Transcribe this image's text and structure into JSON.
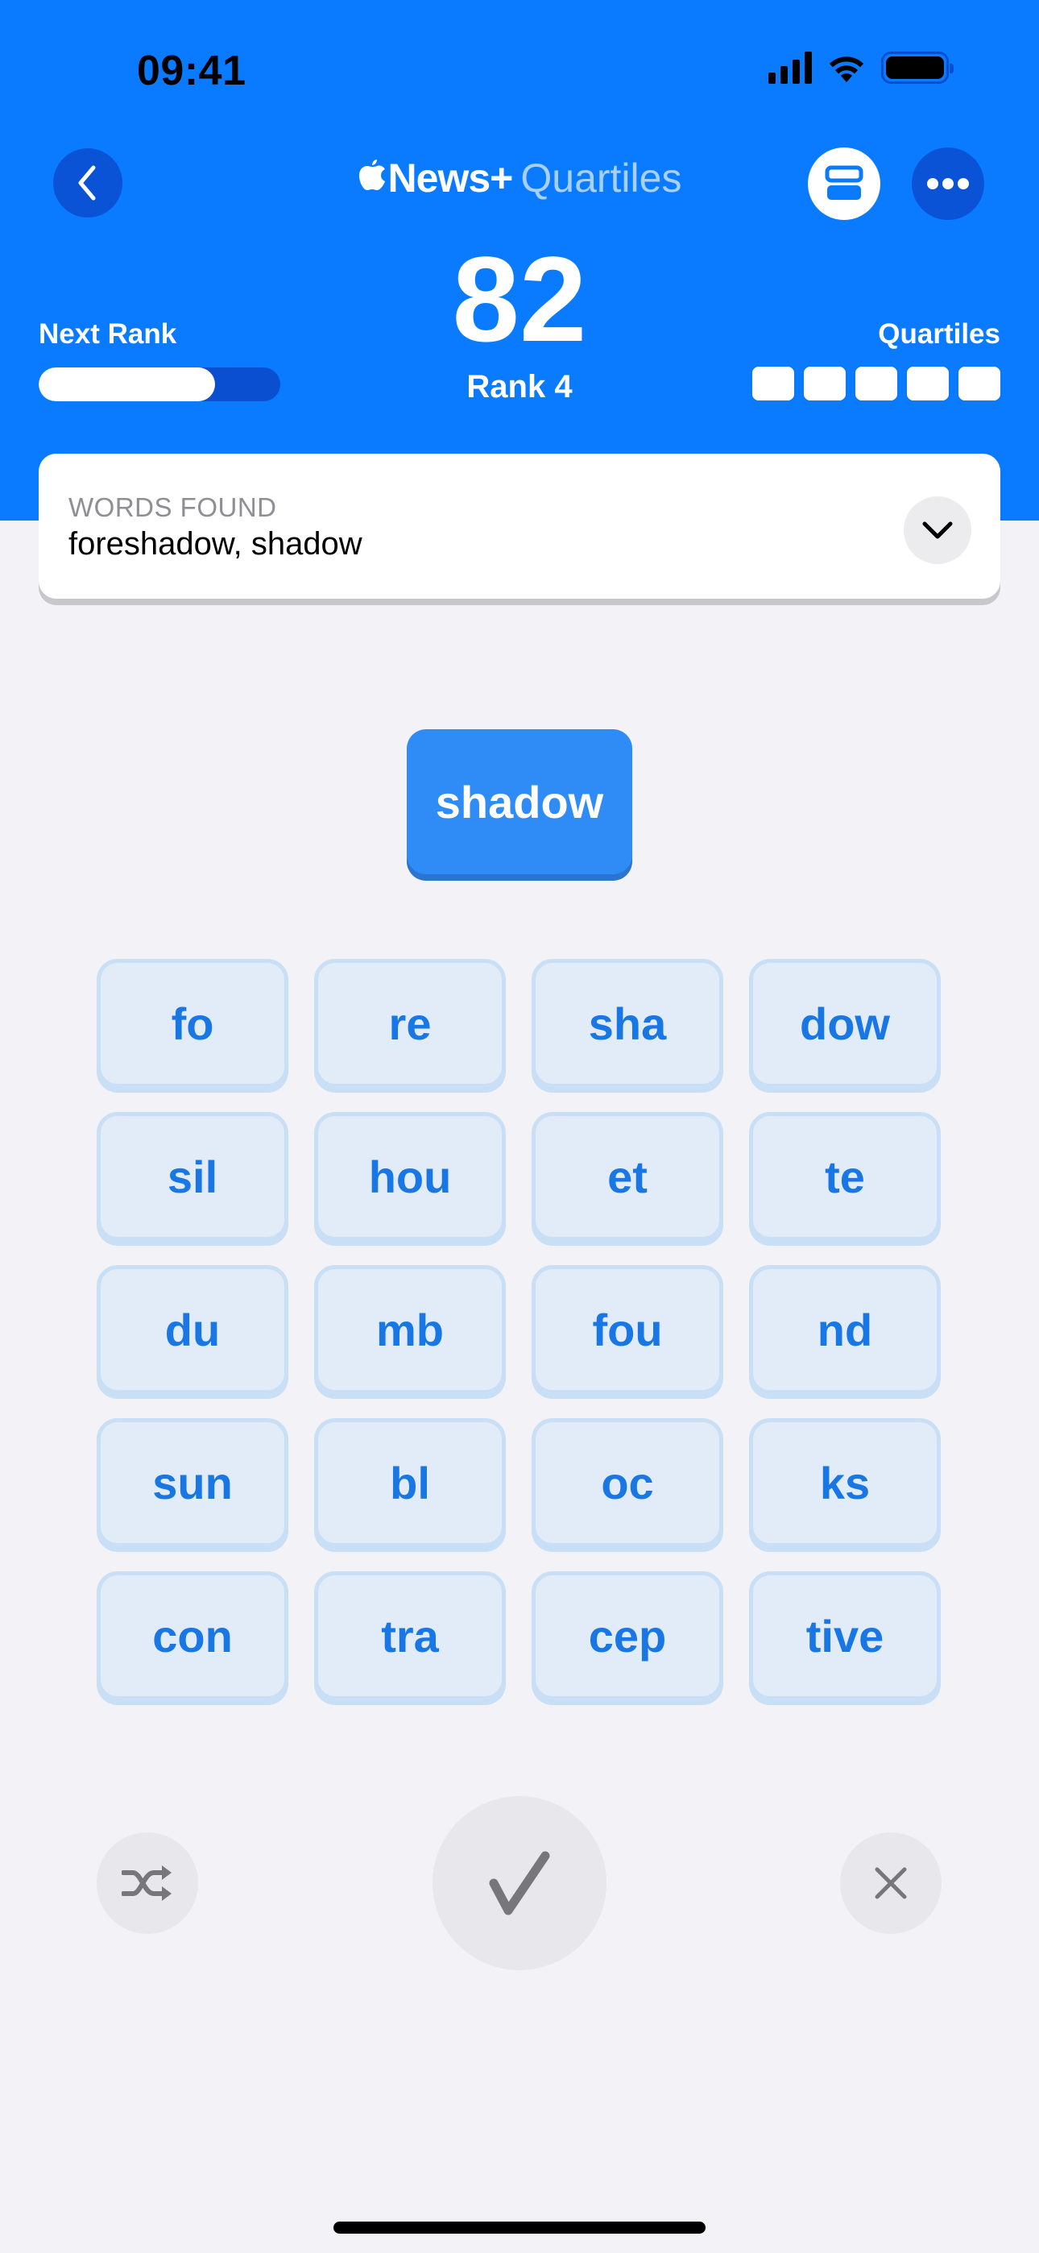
{
  "status_bar": {
    "time": "09:41",
    "icons": [
      "cellular-signal-icon",
      "wifi-icon",
      "battery-icon"
    ]
  },
  "nav": {
    "back_icon": "chevron-left-icon",
    "brand": "News+",
    "brand_logo": "apple-logo-icon",
    "game_title": "Quartiles",
    "ticket_icon": "two-rectangles-icon",
    "more_icon": "ellipsis-icon"
  },
  "score": {
    "points": "82",
    "rank": "Rank 4",
    "next_rank_label": "Next Rank",
    "next_rank_progress": 0.73,
    "quartiles_label": "Quartiles",
    "quartiles_found": 0,
    "quartiles_total": 5
  },
  "words_found": {
    "label": "WORDS FOUND",
    "words": "foreshadow, shadow",
    "expand_icon": "chevron-down-icon"
  },
  "current_word": "shadow",
  "tiles": [
    [
      "fo",
      "re",
      "sha",
      "dow"
    ],
    [
      "sil",
      "hou",
      "et",
      "te"
    ],
    [
      "du",
      "mb",
      "fou",
      "nd"
    ],
    [
      "sun",
      "bl",
      "oc",
      "ks"
    ],
    [
      "con",
      "tra",
      "cep",
      "tive"
    ]
  ],
  "actions": {
    "shuffle_icon": "shuffle-icon",
    "submit_icon": "checkmark-icon",
    "clear_icon": "close-icon"
  },
  "colors": {
    "header_blue": "#0a7bff",
    "tile_text": "#1977e5",
    "current_word_bg": "#2f8bf5",
    "background": "#f2f2f7"
  }
}
